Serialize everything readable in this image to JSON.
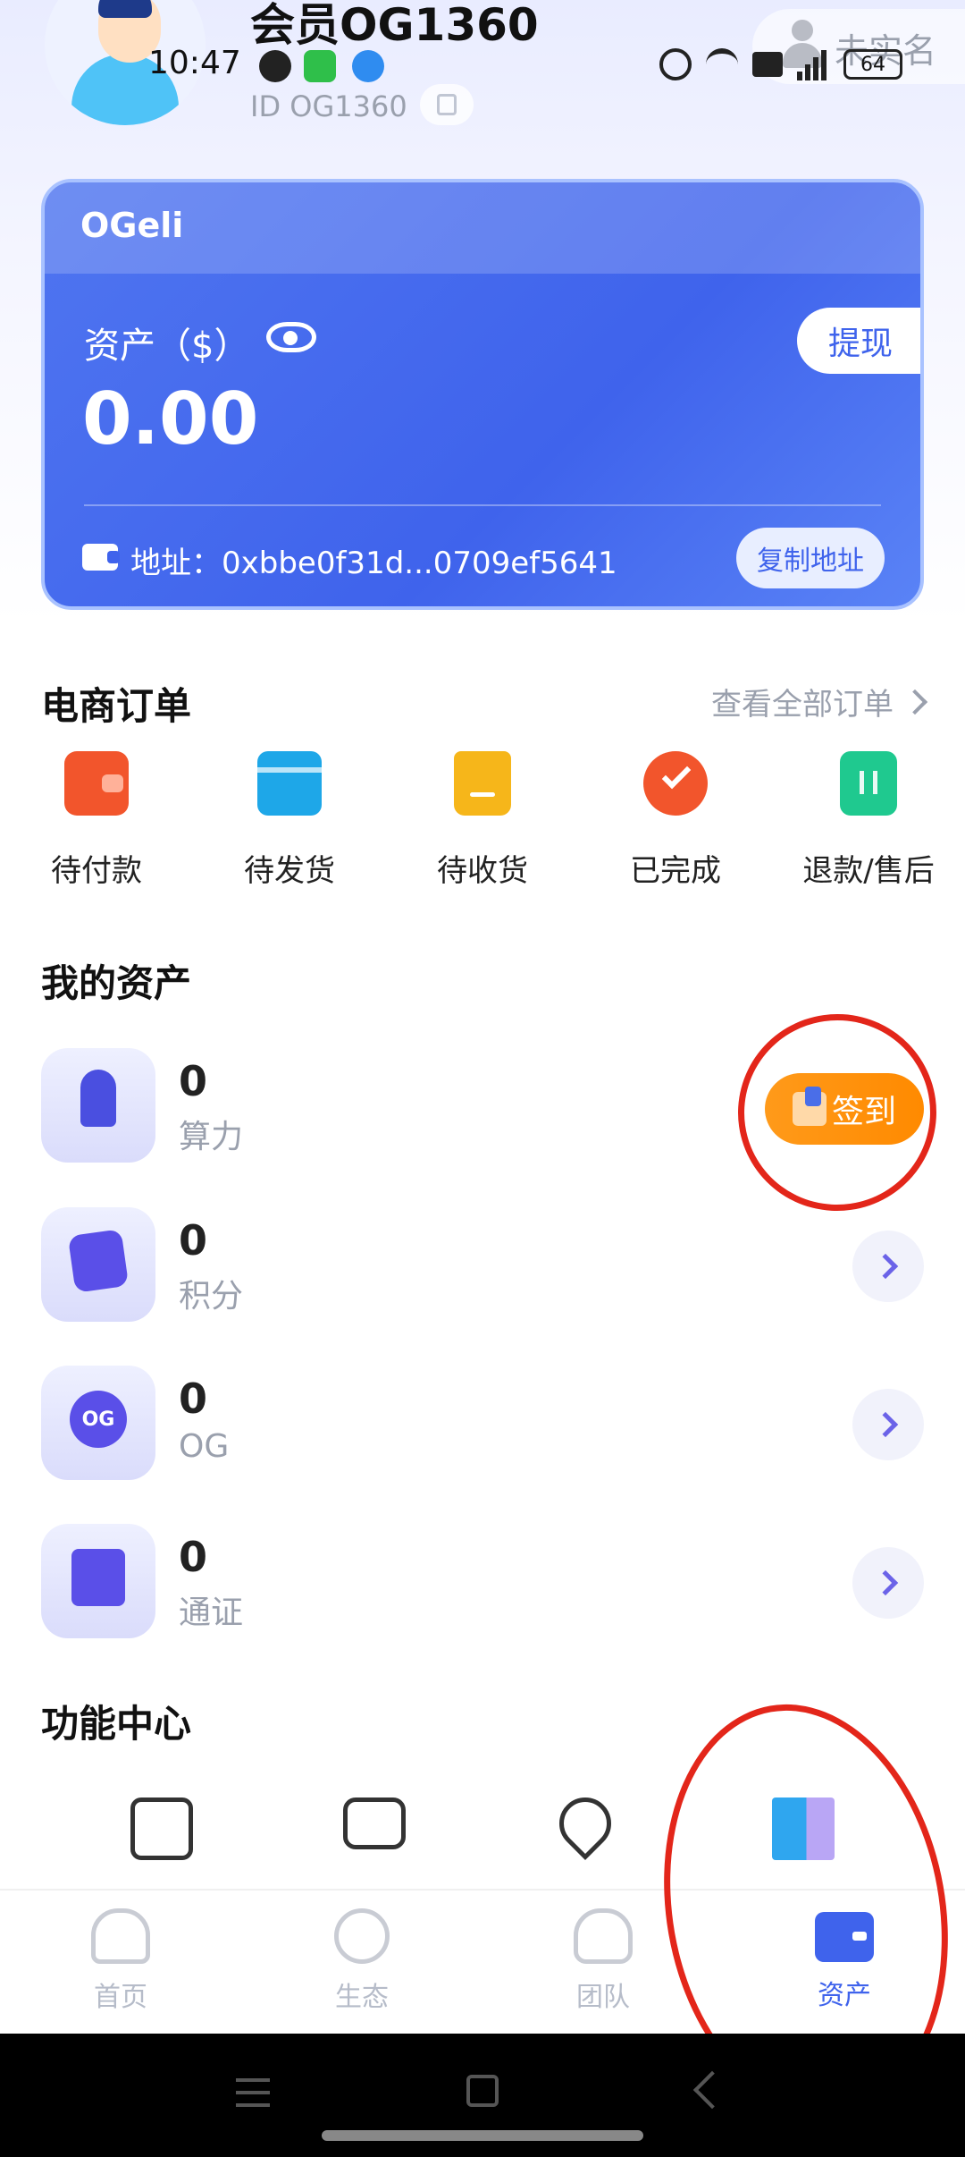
{
  "status_bar": {
    "time": "10:47",
    "battery": "64",
    "network": "4G"
  },
  "profile": {
    "name": "会员OG1360",
    "id_text": "ID OG1360",
    "verify_label": "未实名"
  },
  "wallet_card": {
    "brand": "OGeli",
    "assets_label": "资产（$）",
    "balance": "0.00",
    "withdraw_label": "提现",
    "address_text": "地址：0xbbe0f31d...0709ef5641",
    "copy_address_label": "复制地址",
    "accent_color": "#3f63ec"
  },
  "orders": {
    "title": "电商订单",
    "view_all": "查看全部订单",
    "items": [
      {
        "label": "待付款",
        "icon": "wallet-icon",
        "color": "#f2552c"
      },
      {
        "label": "待发货",
        "icon": "package-icon",
        "color": "#1ea7e8"
      },
      {
        "label": "待收货",
        "icon": "bag-icon",
        "color": "#f6b61a"
      },
      {
        "label": "已完成",
        "icon": "check-circle-icon",
        "color": "#f2552c"
      },
      {
        "label": "退款/售后",
        "icon": "refund-icon",
        "color": "#1fc98f"
      }
    ]
  },
  "my_assets": {
    "title": "我的资产",
    "items": [
      {
        "value": "0",
        "label": "算力",
        "icon": "rocket-icon"
      },
      {
        "value": "0",
        "label": "积分",
        "icon": "star-card-icon"
      },
      {
        "value": "0",
        "label": "OG",
        "icon": "og-coin-icon",
        "icon_text": "OG"
      },
      {
        "value": "0",
        "label": "通证",
        "icon": "document-icon"
      }
    ],
    "checkin_label": "签到"
  },
  "function_center": {
    "title": "功能中心",
    "items": [
      {
        "icon": "settings-sliders-icon"
      },
      {
        "icon": "chat-icon"
      },
      {
        "icon": "location-icon"
      },
      {
        "icon": "building-icon"
      }
    ]
  },
  "bottom_nav": {
    "items": [
      {
        "label": "首页",
        "icon": "home-icon"
      },
      {
        "label": "生态",
        "icon": "ecology-icon"
      },
      {
        "label": "团队",
        "icon": "team-icon"
      },
      {
        "label": "资产",
        "icon": "wallet-icon"
      }
    ],
    "active_index": 3
  }
}
